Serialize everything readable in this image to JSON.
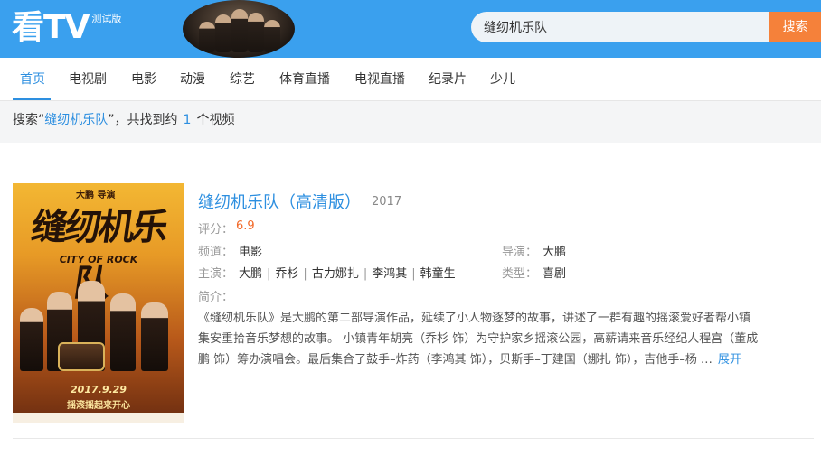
{
  "header": {
    "logo_text": "看TV",
    "logo_badge": "测试版",
    "search_value": "缝纫机乐队",
    "search_button": "搜索"
  },
  "nav": {
    "items": [
      {
        "label": "首页",
        "active": true
      },
      {
        "label": "电视剧"
      },
      {
        "label": "电影"
      },
      {
        "label": "动漫"
      },
      {
        "label": "综艺"
      },
      {
        "label": "体育直播"
      },
      {
        "label": "电视直播"
      },
      {
        "label": "纪录片"
      },
      {
        "label": "少儿"
      }
    ]
  },
  "search_info": {
    "prefix": "搜索“",
    "keyword": "缝纫机乐队",
    "middle": "”，共找到约",
    "count": "1",
    "suffix": "个视频"
  },
  "result": {
    "title": "缝纫机乐队（高清版）",
    "year": "2017",
    "score_label": "评分：",
    "score": "6.9",
    "channel_label": "频道：",
    "channel": "电影",
    "director_label": "导演：",
    "director": "大鹏",
    "cast_label": "主演：",
    "cast": [
      "大鹏",
      "乔杉",
      "古力娜扎",
      "李鸿其",
      "韩童生"
    ],
    "genre_label": "类型：",
    "genre": "喜剧",
    "intro_label": "简介：",
    "intro_lines": [
      "《缝纫机乐队》是大鹏的第二部导演作品，延续了小人物逐梦的故事，讲述了一群有趣的摇滚爱好者帮小镇",
      "集安重拾音乐梦想的故事。 小镇青年胡亮（乔杉 饰）为守护家乡摇滚公园，高薪请来音乐经纪人程宫（董成",
      "鹏 饰）筹办演唱会。最后集合了鼓手–炸药（李鸿其 饰），贝斯手–丁建国（娜扎 饰），吉他手–杨"
    ],
    "ellipsis": "…",
    "expand_label": "展开",
    "poster": {
      "credit": "大鹏  导演",
      "title_art": "缝纫机乐队",
      "subtitle_art": "CITY OF ROCK",
      "date": "2017.9.29",
      "slogan": "摇滚摇起来开心"
    }
  },
  "colors": {
    "header_bg": "#3aa0ee",
    "accent": "#2d8fe0",
    "search_button": "#f5813a",
    "score": "#f26a2a"
  }
}
